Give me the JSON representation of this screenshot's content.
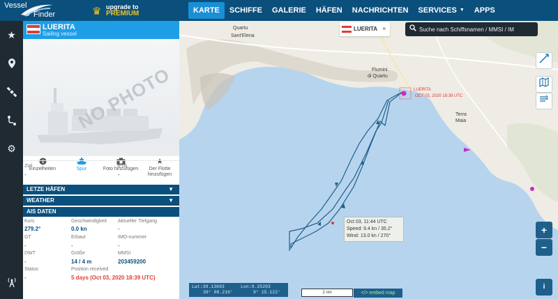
{
  "brand": {
    "name_line1": "Vessel",
    "name_line2": "Finder"
  },
  "upgrade": {
    "line1": "upgrade to",
    "line2": "PREMIUM"
  },
  "nav": [
    {
      "label": "KARTE",
      "active": true
    },
    {
      "label": "SCHIFFE"
    },
    {
      "label": "GALERIE"
    },
    {
      "label": "HÄFEN"
    },
    {
      "label": "NACHRICHTEN"
    },
    {
      "label": "SERVICES",
      "dropdown": true
    },
    {
      "label": "APPS"
    }
  ],
  "rail_icons": [
    "star-icon",
    "map-pin-icon",
    "satellite-icon",
    "route-icon",
    "gear-icon",
    "antenna-icon"
  ],
  "vessel": {
    "name": "LUERITA",
    "type": "Sailing vessel",
    "photo_placeholder": "NO PHOTO",
    "flag_colors": [
      "#e03c31",
      "#ffffff",
      "#e03c31"
    ]
  },
  "actions": [
    {
      "label": "Einzelheiten",
      "icon": "info-icon"
    },
    {
      "label": "Spur",
      "icon": "ship-track-icon",
      "selected": true
    },
    {
      "label": "Foto hinzufügen",
      "icon": "camera-icon"
    },
    {
      "label": "Der Flotte hinzufügen",
      "icon": "star-icon"
    }
  ],
  "voyage": {
    "ziel_label": "Ziel",
    "ziel_value": "-",
    "eta_label": "ETA",
    "eta_value": "-"
  },
  "sections": {
    "last_ports": "LETZE HÄFEN",
    "weather": "WEATHER",
    "ais": "AIS DATEN"
  },
  "ais": {
    "kurs_label": "Kurs",
    "kurs_value": "279.2°",
    "speed_label": "Geschwindigkeit",
    "speed_value": "0.0 kn",
    "draught_label": "Aktueller Tiefgang",
    "draught_value": "-",
    "gt_label": "GT",
    "gt_value": "-",
    "built_label": "Erbaut",
    "built_value": "-",
    "imo_label": "IMO-nummer",
    "imo_value": "-",
    "dwt_label": "DWT",
    "dwt_value": "-",
    "size_label": "Größe",
    "size_value": "14 / 4 m",
    "mmsi_label": "MMSI",
    "mmsi_value": "203459200",
    "status_label": "Status",
    "status_value": "-",
    "position_label": "Position received",
    "position_value": "5 days (Oct 03, 2020 18:39 UTC)"
  },
  "map": {
    "tab_name": "LUERITA",
    "tab_close": "×",
    "search_placeholder": "Suche nach Schiffsnamen / MMSI / IM",
    "places": {
      "quartu": "Quartu",
      "sant_elena": "Sant'Elena",
      "flumini_1": "Flumini",
      "flumini_2": "di Quartu",
      "terra_1": "Terra",
      "terra_2": "Maia"
    },
    "marker_name": "LUERITA",
    "marker_time": "OCT 03, 2020 18:39 UTC",
    "tooltip": {
      "time": "Oct 03, 11:44 UTC",
      "speed": "Speed: 9.4 kn / 35.2°",
      "wind": "Wind: 13.0 kn / 270°"
    },
    "coords": {
      "lat_label": "Lat:39.13693",
      "lon_label": "Lon:9.25203",
      "lat_dms": "39° 08.216'",
      "lon_dms": "9° 15.122'"
    },
    "scale": "2 nm",
    "embed": "</> embed map",
    "zoom_in": "+",
    "zoom_out": "−",
    "info": "i",
    "water_color": "#b7d4ee",
    "land_color": "#eeece4",
    "track_color": "#1f5f8b"
  }
}
